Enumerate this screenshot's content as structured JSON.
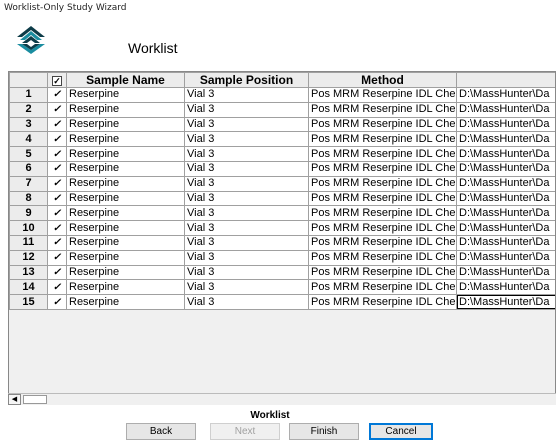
{
  "window": {
    "title": "Worklist-Only Study Wizard"
  },
  "page": {
    "heading": "Worklist",
    "footer_label": "Worklist"
  },
  "icons": {
    "logo": "stacked-chevrons-logo-icon",
    "scroll_left": "scroll-left-arrow-icon"
  },
  "colors": {
    "logo_teal": "#1a8da0",
    "logo_dark": "#0d3c48",
    "focus_border": "#0078d7"
  },
  "grid": {
    "columns": [
      "",
      "✓",
      "Sample Name",
      "Sample Position",
      "Method",
      ""
    ],
    "rows": [
      {
        "num": "1",
        "checked": "✓",
        "sample_name": "Reserpine",
        "sample_position": "Vial 3",
        "method": "Pos MRM Reserpine IDL Che",
        "path": "D:\\MassHunter\\Da"
      },
      {
        "num": "2",
        "checked": "✓",
        "sample_name": "Reserpine",
        "sample_position": "Vial 3",
        "method": "Pos MRM Reserpine IDL Che",
        "path": "D:\\MassHunter\\Da"
      },
      {
        "num": "3",
        "checked": "✓",
        "sample_name": "Reserpine",
        "sample_position": "Vial 3",
        "method": "Pos MRM Reserpine IDL Che",
        "path": "D:\\MassHunter\\Da"
      },
      {
        "num": "4",
        "checked": "✓",
        "sample_name": "Reserpine",
        "sample_position": "Vial 3",
        "method": "Pos MRM Reserpine IDL Che",
        "path": "D:\\MassHunter\\Da"
      },
      {
        "num": "5",
        "checked": "✓",
        "sample_name": "Reserpine",
        "sample_position": "Vial 3",
        "method": "Pos MRM Reserpine IDL Che",
        "path": "D:\\MassHunter\\Da"
      },
      {
        "num": "6",
        "checked": "✓",
        "sample_name": "Reserpine",
        "sample_position": "Vial 3",
        "method": "Pos MRM Reserpine IDL Che",
        "path": "D:\\MassHunter\\Da"
      },
      {
        "num": "7",
        "checked": "✓",
        "sample_name": "Reserpine",
        "sample_position": "Vial 3",
        "method": "Pos MRM Reserpine IDL Che",
        "path": "D:\\MassHunter\\Da"
      },
      {
        "num": "8",
        "checked": "✓",
        "sample_name": "Reserpine",
        "sample_position": "Vial 3",
        "method": "Pos MRM Reserpine IDL Che",
        "path": "D:\\MassHunter\\Da"
      },
      {
        "num": "9",
        "checked": "✓",
        "sample_name": "Reserpine",
        "sample_position": "Vial 3",
        "method": "Pos MRM Reserpine IDL Che",
        "path": "D:\\MassHunter\\Da"
      },
      {
        "num": "10",
        "checked": "✓",
        "sample_name": "Reserpine",
        "sample_position": "Vial 3",
        "method": "Pos MRM Reserpine IDL Che",
        "path": "D:\\MassHunter\\Da"
      },
      {
        "num": "11",
        "checked": "✓",
        "sample_name": "Reserpine",
        "sample_position": "Vial 3",
        "method": "Pos MRM Reserpine IDL Che",
        "path": "D:\\MassHunter\\Da"
      },
      {
        "num": "12",
        "checked": "✓",
        "sample_name": "Reserpine",
        "sample_position": "Vial 3",
        "method": "Pos MRM Reserpine IDL Che",
        "path": "D:\\MassHunter\\Da"
      },
      {
        "num": "13",
        "checked": "✓",
        "sample_name": "Reserpine",
        "sample_position": "Vial 3",
        "method": "Pos MRM Reserpine IDL Che",
        "path": "D:\\MassHunter\\Da"
      },
      {
        "num": "14",
        "checked": "✓",
        "sample_name": "Reserpine",
        "sample_position": "Vial 3",
        "method": "Pos MRM Reserpine IDL Che",
        "path": "D:\\MassHunter\\Da"
      },
      {
        "num": "15",
        "checked": "✓",
        "sample_name": "Reserpine",
        "sample_position": "Vial 3",
        "method": "Pos MRM Reserpine IDL Che",
        "path": "D:\\MassHunter\\Da"
      }
    ]
  },
  "buttons": {
    "back": "Back",
    "next": "Next",
    "finish": "Finish",
    "cancel": "Cancel"
  }
}
